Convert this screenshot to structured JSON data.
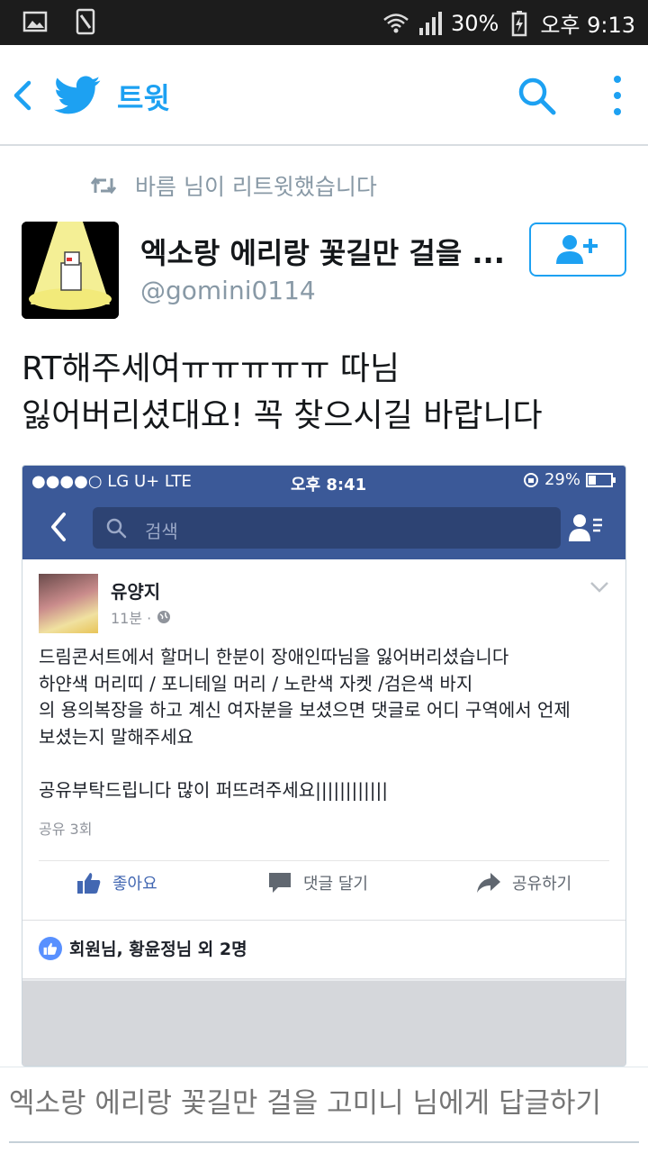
{
  "status_bar": {
    "battery": "30%",
    "time": "오후 9:13"
  },
  "app_bar": {
    "title": "트윗",
    "icons": [
      "back-chevron-icon",
      "twitter-bird-icon",
      "search-icon",
      "overflow-menu-icon"
    ]
  },
  "retweet": {
    "text": "바름 님이 리트윗했습니다",
    "icon": "retweet-icon"
  },
  "author": {
    "name": "엑소랑 에리랑 꽃길만 걸을 ...",
    "handle": "@gomini0114",
    "follow_icon": "add-user-icon"
  },
  "tweet": {
    "lines": [
      "RT해주세여ㅠㅠㅠㅠㅠ 따님",
      "잃어버리셨대요! 꼭 찾으시길 바랍니다"
    ]
  },
  "embedded": {
    "status": {
      "carrier": "●●●●○ LG U+  LTE",
      "time": "오후 8:41",
      "battery": "29%"
    },
    "search_placeholder": "검색",
    "post": {
      "name": "유양지",
      "time": "11분 ·",
      "body": [
        "드림콘서트에서 할머니 한분이 장애인따님을 잃어버리셨습니다",
        "하얀색 머리띠 / 포니테일 머리 / 노란색 자켓 /검은색 바지",
        "의 용의복장을 하고 계신 여자분을 보셨으면 댓글로 어디 구역에서 언제",
        "보셨는지 말해주세요",
        "",
        "공유부탁드립니다 많이 퍼뜨려주세요||||||||||||"
      ],
      "shares": "공유 3회",
      "actions": {
        "like": "좋아요",
        "comment": "댓글 달기",
        "share": "공유하기"
      },
      "likes": "회원님, 황윤정님 외 2명"
    },
    "colors": {
      "facebook_blue": "#3b5998",
      "like_blue": "#5890ff"
    }
  },
  "reply": {
    "placeholder": "엑소랑 에리랑 꽃길만 걸을 고미니 님에게 답글하기"
  },
  "colors": {
    "twitter_blue": "#1da1f2",
    "muted": "#8899a6"
  }
}
